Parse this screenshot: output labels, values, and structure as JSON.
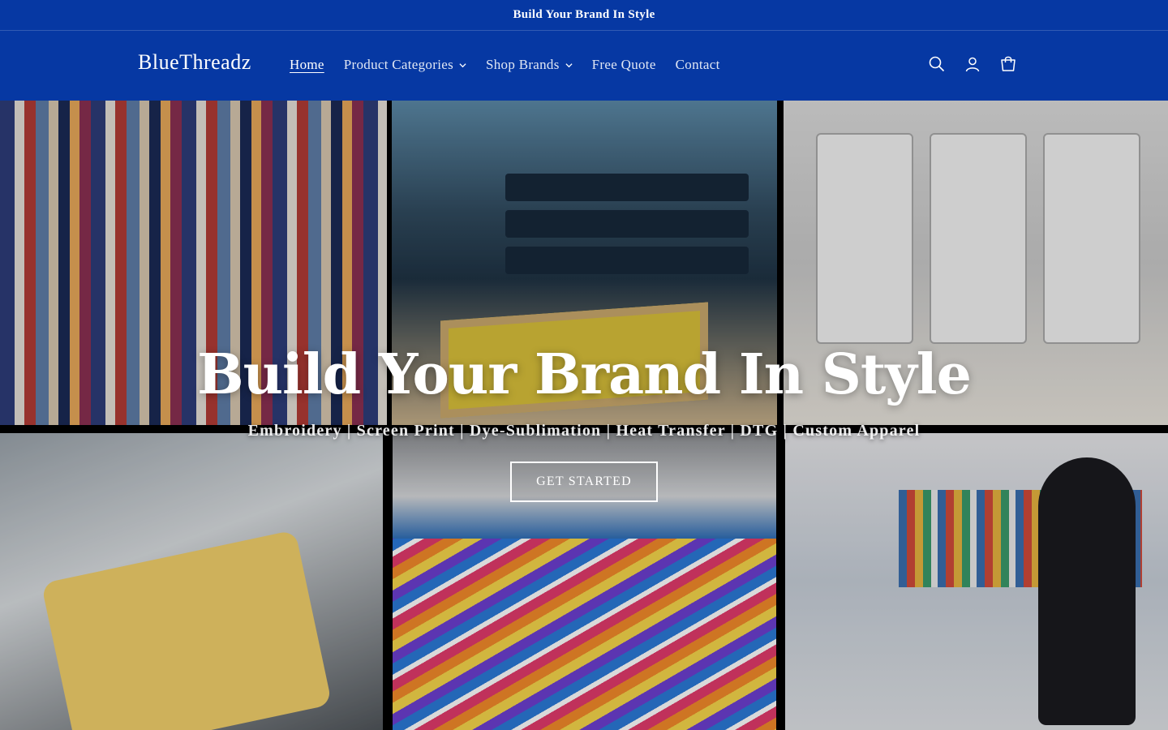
{
  "announcement": {
    "text": "Build Your Brand In Style"
  },
  "header": {
    "logo": "BlueThreadz",
    "nav": [
      {
        "label": "Home",
        "active": true,
        "dropdown": false
      },
      {
        "label": "Product Categories",
        "active": false,
        "dropdown": true
      },
      {
        "label": "Shop Brands",
        "active": false,
        "dropdown": true
      },
      {
        "label": "Free Quote",
        "active": false,
        "dropdown": false
      },
      {
        "label": "Contact",
        "active": false,
        "dropdown": false
      }
    ],
    "icons": [
      "search-icon",
      "account-icon",
      "cart-icon"
    ]
  },
  "hero": {
    "title": "Build Your Brand In Style",
    "subtitle": "Embroidery | Screen Print | Dye-Sublimation | Heat Transfer | DTG | Custom Apparel",
    "cta_label": "GET STARTED"
  },
  "colors": {
    "brand_blue": "#0638a3",
    "text": "#ffffff"
  }
}
